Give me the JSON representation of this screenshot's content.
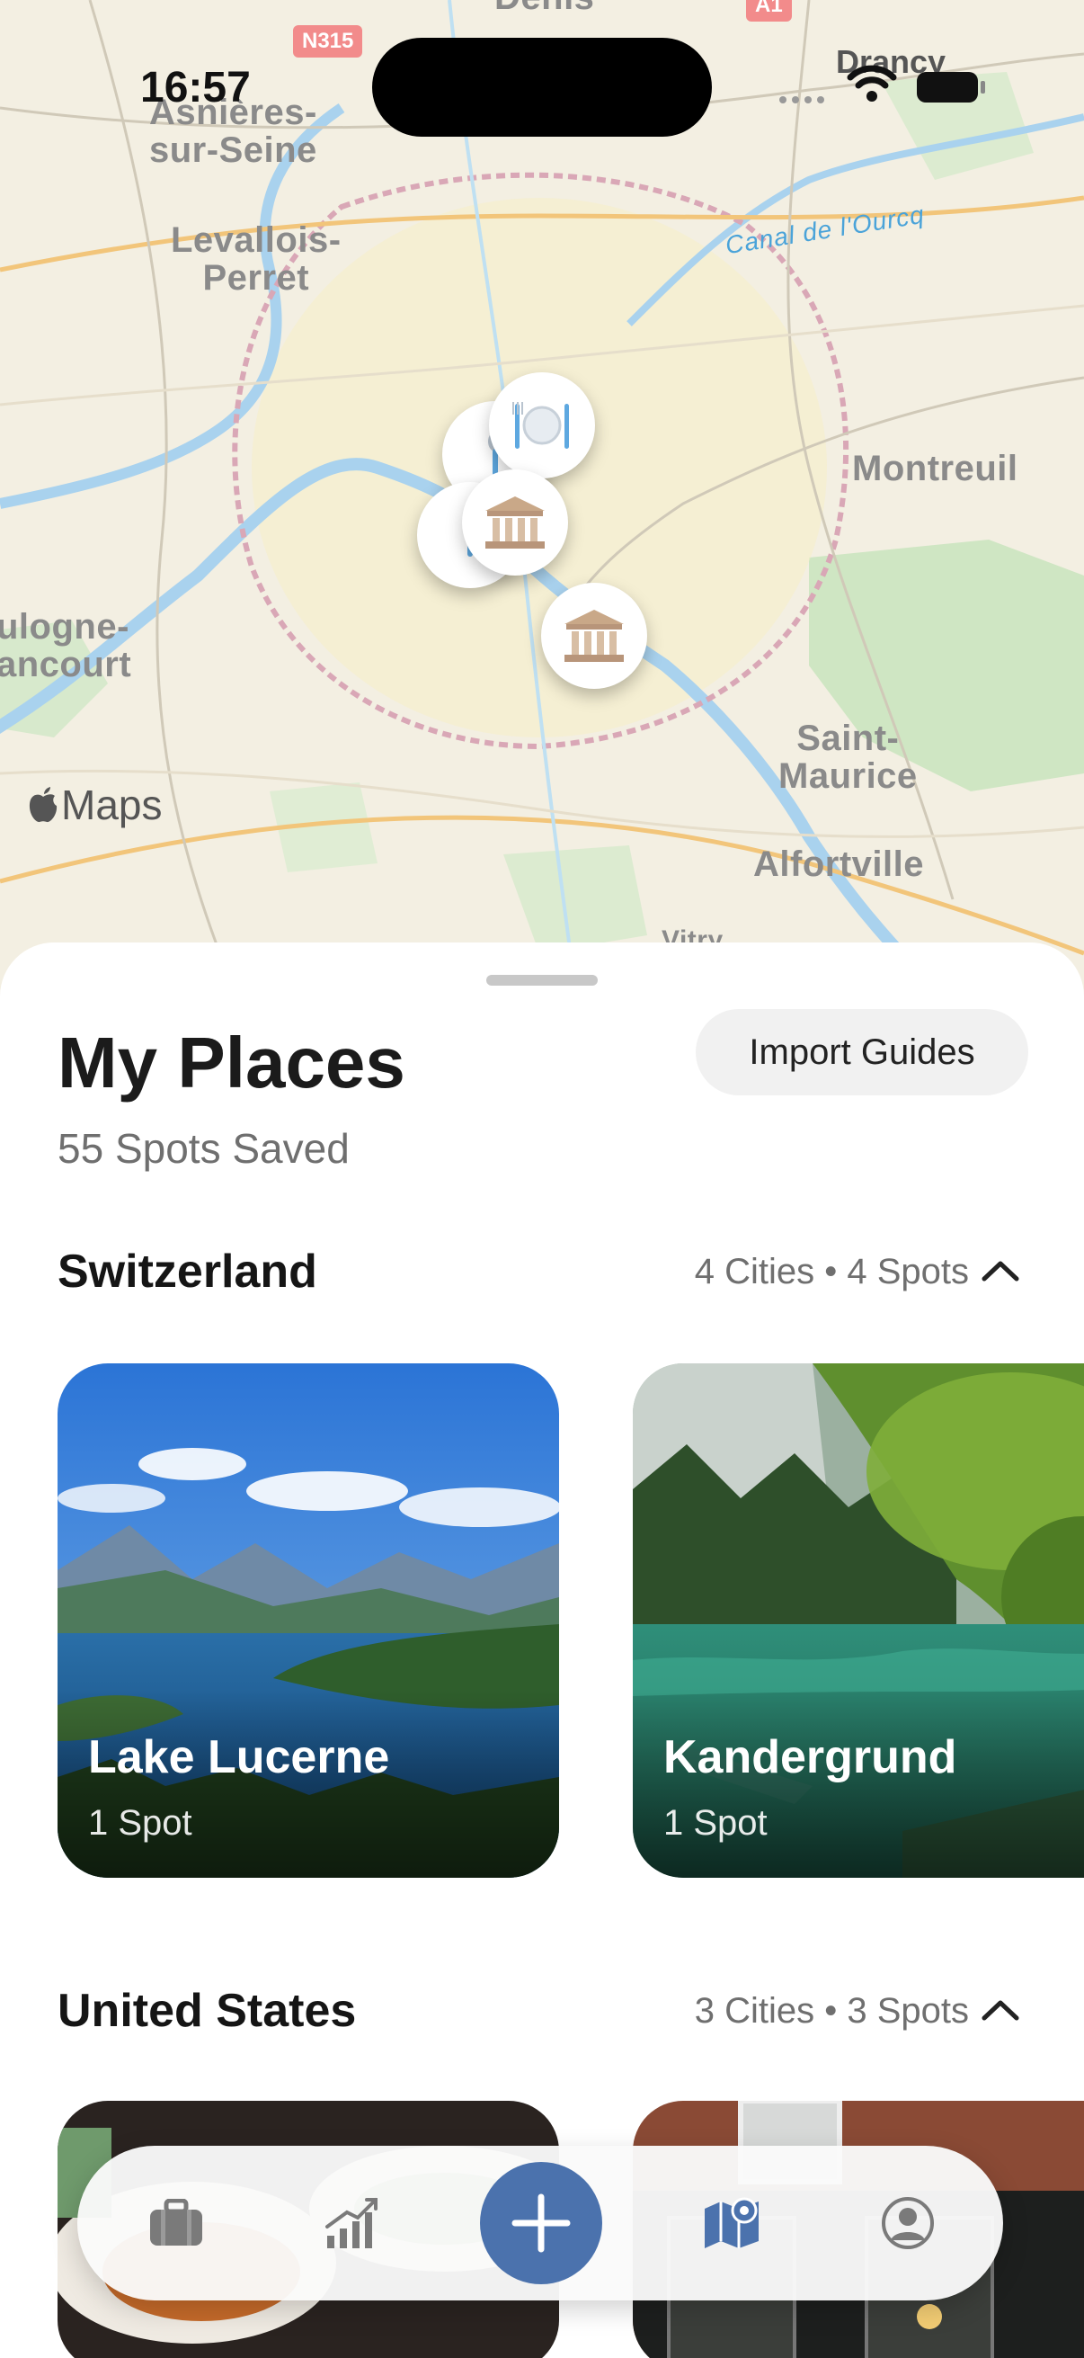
{
  "status_bar": {
    "time": "16:57",
    "carrier": "Drancy"
  },
  "map": {
    "labels": {
      "asnieres": "Asnières-\nsur-Seine",
      "levallois": "Levallois-\nPerret",
      "montreuil": "Montreuil",
      "boulogne": "ulogne-\nancourt",
      "saint_maurice": "Saint-\nMaurice",
      "alfortville": "Alfortville",
      "denis": "Denis",
      "vitry": "Vitry"
    },
    "water_label": "Canal de l'Ourcq",
    "road_shield": "N315",
    "road_shield_top": "A1",
    "attribution": "Maps"
  },
  "sheet": {
    "title": "My Places",
    "subtitle": "55 Spots Saved",
    "import_button": "Import Guides",
    "sections": [
      {
        "name": "Switzerland",
        "meta": "4 Cities • 4 Spots",
        "cards": [
          {
            "title": "Lake Lucerne",
            "subtitle": "1 Spot"
          },
          {
            "title": "Kandergrund",
            "subtitle": "1 Spot"
          }
        ]
      },
      {
        "name": "United States",
        "meta": "3 Cities • 3 Spots",
        "cards": []
      }
    ]
  },
  "tab_bar": {
    "tabs": [
      "trips-icon",
      "stats-icon",
      "add-icon",
      "map-icon",
      "profile-icon"
    ],
    "accent": "#4b72ad"
  }
}
